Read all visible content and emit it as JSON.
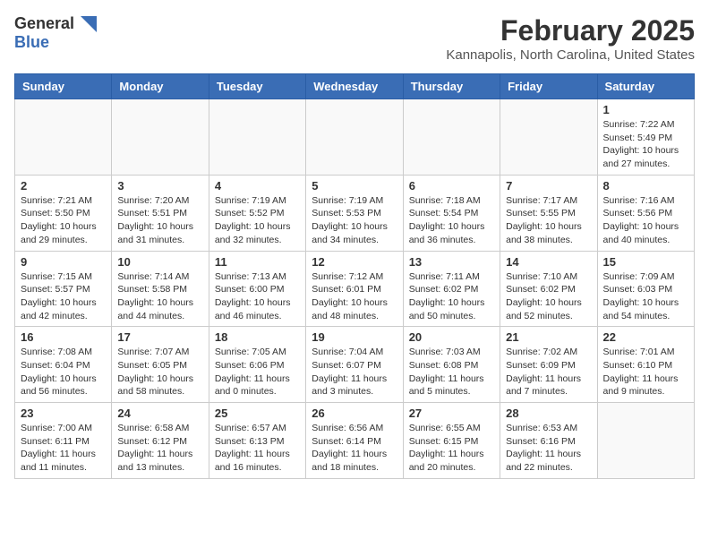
{
  "header": {
    "logo_general": "General",
    "logo_blue": "Blue",
    "month_year": "February 2025",
    "location": "Kannapolis, North Carolina, United States"
  },
  "days_of_week": [
    "Sunday",
    "Monday",
    "Tuesday",
    "Wednesday",
    "Thursday",
    "Friday",
    "Saturday"
  ],
  "weeks": [
    [
      {
        "day": "",
        "info": ""
      },
      {
        "day": "",
        "info": ""
      },
      {
        "day": "",
        "info": ""
      },
      {
        "day": "",
        "info": ""
      },
      {
        "day": "",
        "info": ""
      },
      {
        "day": "",
        "info": ""
      },
      {
        "day": "1",
        "info": "Sunrise: 7:22 AM\nSunset: 5:49 PM\nDaylight: 10 hours and 27 minutes."
      }
    ],
    [
      {
        "day": "2",
        "info": "Sunrise: 7:21 AM\nSunset: 5:50 PM\nDaylight: 10 hours and 29 minutes."
      },
      {
        "day": "3",
        "info": "Sunrise: 7:20 AM\nSunset: 5:51 PM\nDaylight: 10 hours and 31 minutes."
      },
      {
        "day": "4",
        "info": "Sunrise: 7:19 AM\nSunset: 5:52 PM\nDaylight: 10 hours and 32 minutes."
      },
      {
        "day": "5",
        "info": "Sunrise: 7:19 AM\nSunset: 5:53 PM\nDaylight: 10 hours and 34 minutes."
      },
      {
        "day": "6",
        "info": "Sunrise: 7:18 AM\nSunset: 5:54 PM\nDaylight: 10 hours and 36 minutes."
      },
      {
        "day": "7",
        "info": "Sunrise: 7:17 AM\nSunset: 5:55 PM\nDaylight: 10 hours and 38 minutes."
      },
      {
        "day": "8",
        "info": "Sunrise: 7:16 AM\nSunset: 5:56 PM\nDaylight: 10 hours and 40 minutes."
      }
    ],
    [
      {
        "day": "9",
        "info": "Sunrise: 7:15 AM\nSunset: 5:57 PM\nDaylight: 10 hours and 42 minutes."
      },
      {
        "day": "10",
        "info": "Sunrise: 7:14 AM\nSunset: 5:58 PM\nDaylight: 10 hours and 44 minutes."
      },
      {
        "day": "11",
        "info": "Sunrise: 7:13 AM\nSunset: 6:00 PM\nDaylight: 10 hours and 46 minutes."
      },
      {
        "day": "12",
        "info": "Sunrise: 7:12 AM\nSunset: 6:01 PM\nDaylight: 10 hours and 48 minutes."
      },
      {
        "day": "13",
        "info": "Sunrise: 7:11 AM\nSunset: 6:02 PM\nDaylight: 10 hours and 50 minutes."
      },
      {
        "day": "14",
        "info": "Sunrise: 7:10 AM\nSunset: 6:02 PM\nDaylight: 10 hours and 52 minutes."
      },
      {
        "day": "15",
        "info": "Sunrise: 7:09 AM\nSunset: 6:03 PM\nDaylight: 10 hours and 54 minutes."
      }
    ],
    [
      {
        "day": "16",
        "info": "Sunrise: 7:08 AM\nSunset: 6:04 PM\nDaylight: 10 hours and 56 minutes."
      },
      {
        "day": "17",
        "info": "Sunrise: 7:07 AM\nSunset: 6:05 PM\nDaylight: 10 hours and 58 minutes."
      },
      {
        "day": "18",
        "info": "Sunrise: 7:05 AM\nSunset: 6:06 PM\nDaylight: 11 hours and 0 minutes."
      },
      {
        "day": "19",
        "info": "Sunrise: 7:04 AM\nSunset: 6:07 PM\nDaylight: 11 hours and 3 minutes."
      },
      {
        "day": "20",
        "info": "Sunrise: 7:03 AM\nSunset: 6:08 PM\nDaylight: 11 hours and 5 minutes."
      },
      {
        "day": "21",
        "info": "Sunrise: 7:02 AM\nSunset: 6:09 PM\nDaylight: 11 hours and 7 minutes."
      },
      {
        "day": "22",
        "info": "Sunrise: 7:01 AM\nSunset: 6:10 PM\nDaylight: 11 hours and 9 minutes."
      }
    ],
    [
      {
        "day": "23",
        "info": "Sunrise: 7:00 AM\nSunset: 6:11 PM\nDaylight: 11 hours and 11 minutes."
      },
      {
        "day": "24",
        "info": "Sunrise: 6:58 AM\nSunset: 6:12 PM\nDaylight: 11 hours and 13 minutes."
      },
      {
        "day": "25",
        "info": "Sunrise: 6:57 AM\nSunset: 6:13 PM\nDaylight: 11 hours and 16 minutes."
      },
      {
        "day": "26",
        "info": "Sunrise: 6:56 AM\nSunset: 6:14 PM\nDaylight: 11 hours and 18 minutes."
      },
      {
        "day": "27",
        "info": "Sunrise: 6:55 AM\nSunset: 6:15 PM\nDaylight: 11 hours and 20 minutes."
      },
      {
        "day": "28",
        "info": "Sunrise: 6:53 AM\nSunset: 6:16 PM\nDaylight: 11 hours and 22 minutes."
      },
      {
        "day": "",
        "info": ""
      }
    ]
  ]
}
